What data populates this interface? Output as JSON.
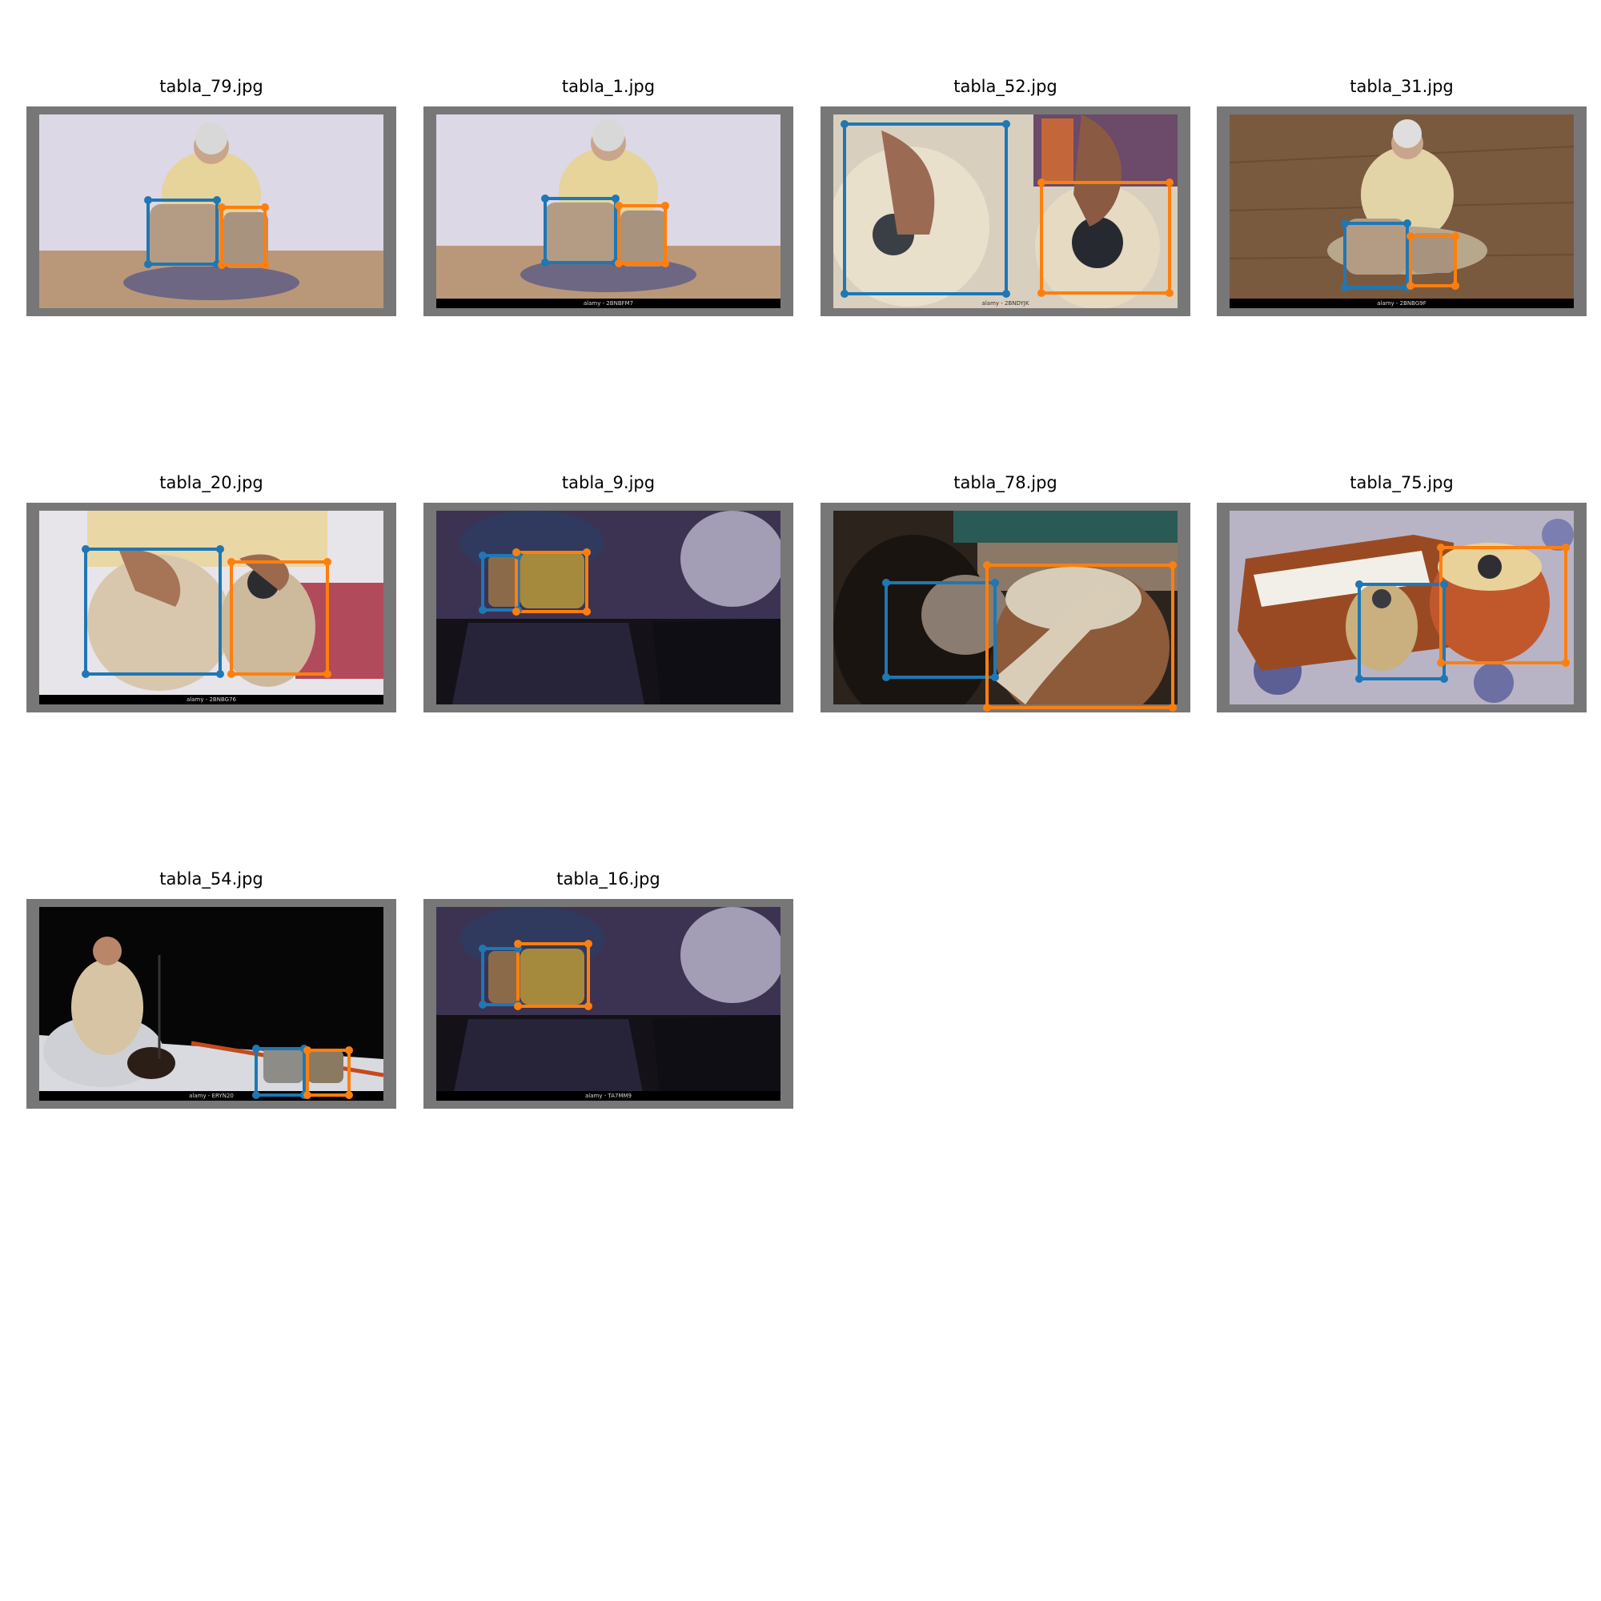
{
  "colors": {
    "class_a_box": "#1f77b4",
    "class_b_box": "#ff7f0e",
    "frame": "#777777"
  },
  "panels": [
    {
      "title": "tabla_79.jpg",
      "watermark": "",
      "scene": "white-wall-sitting"
    },
    {
      "title": "tabla_1.jpg",
      "watermark": "alamy - 2BNBFM7",
      "scene": "white-wall-sitting"
    },
    {
      "title": "tabla_52.jpg",
      "watermark": "alamy - 2BNDYJK",
      "scene": "closeup-hands"
    },
    {
      "title": "tabla_31.jpg",
      "watermark": "alamy - 2BNBG9F",
      "scene": "wood-floor-sitting"
    },
    {
      "title": "tabla_20.jpg",
      "watermark": "alamy - 2BNBG76",
      "scene": "closeup-white"
    },
    {
      "title": "tabla_9.jpg",
      "watermark": "",
      "scene": "stage-dark"
    },
    {
      "title": "tabla_78.jpg",
      "watermark": "",
      "scene": "dark-hands"
    },
    {
      "title": "tabla_75.jpg",
      "watermark": "",
      "scene": "harmonium"
    },
    {
      "title": "tabla_54.jpg",
      "watermark": "alamy - ERYN20",
      "scene": "stage-performer"
    },
    {
      "title": "tabla_16.jpg",
      "watermark": "alamy - TA7MM9",
      "scene": "stage-dark"
    }
  ]
}
